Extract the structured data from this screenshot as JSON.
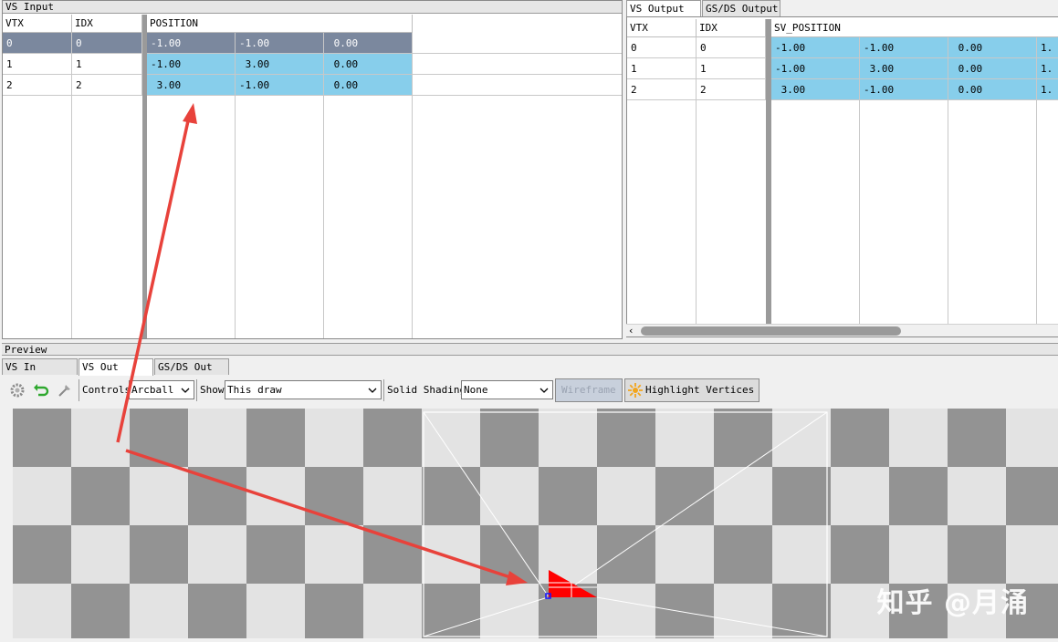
{
  "vs_input": {
    "title": "VS Input",
    "columns": [
      "VTX",
      "IDX",
      "POSITION"
    ],
    "rows": [
      {
        "vtx": "0",
        "idx": "0",
        "pos": [
          "-1.00",
          "-1.00",
          " 0.00"
        ]
      },
      {
        "vtx": "1",
        "idx": "1",
        "pos": [
          "-1.00",
          " 3.00",
          " 0.00"
        ]
      },
      {
        "vtx": "2",
        "idx": "2",
        "pos": [
          " 3.00",
          "-1.00",
          " 0.00"
        ]
      }
    ]
  },
  "output_tabs": [
    "VS Output",
    "GS/DS Output"
  ],
  "vs_output": {
    "columns": [
      "VTX",
      "IDX",
      "SV_POSITION"
    ],
    "rows": [
      {
        "vtx": "0",
        "idx": "0",
        "pos": [
          "-1.00",
          "-1.00",
          " 0.00",
          "1."
        ]
      },
      {
        "vtx": "1",
        "idx": "1",
        "pos": [
          "-1.00",
          " 3.00",
          " 0.00",
          "1."
        ]
      },
      {
        "vtx": "2",
        "idx": "2",
        "pos": [
          " 3.00",
          "-1.00",
          " 0.00",
          "1."
        ]
      }
    ]
  },
  "preview": {
    "title": "Preview",
    "tabs": [
      "VS In",
      "VS Out",
      "GS/DS Out"
    ],
    "toolbar": {
      "controls_label": "Controls",
      "controls_value": "Arcball",
      "show_label": "Show",
      "show_value": "This draw",
      "shading_label": "Solid Shading",
      "shading_value": "None",
      "wireframe_label": "Wireframe",
      "highlight_label": "Highlight Vertices"
    },
    "icons": [
      "settings-icon",
      "reset-icon",
      "pick-icon"
    ]
  },
  "colors": {
    "selected_row": "#7b889e",
    "highlight_cells": "#87ceeb",
    "triangle": "#ff0000",
    "annotation_arrow": "#e8423b"
  },
  "watermark": "知乎 @月涌"
}
